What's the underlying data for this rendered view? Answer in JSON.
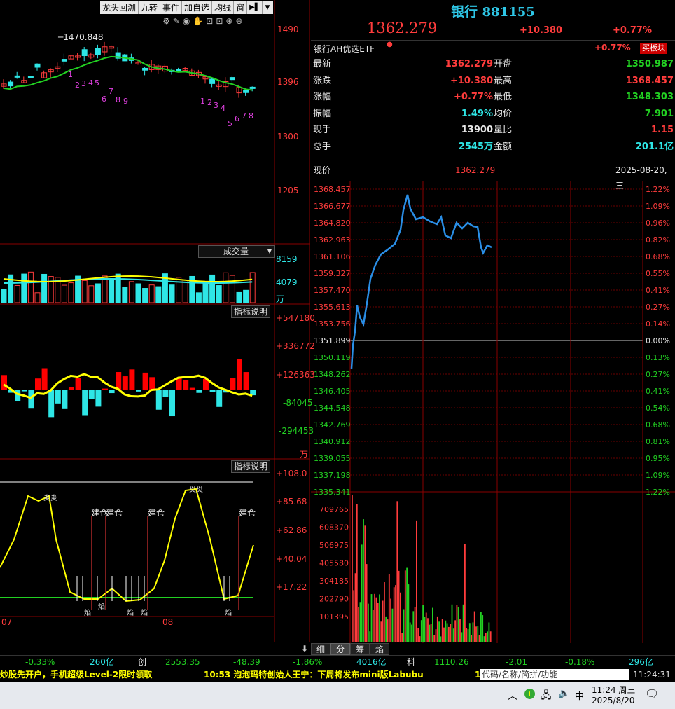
{
  "toolbar": {
    "items": [
      "龙头回溯",
      "九转",
      "事件",
      "加自选",
      "均线",
      "窗"
    ],
    "arrow_icon": "arrow-right-bar-icon",
    "dropdown_icon": "chevron-down-icon"
  },
  "kline": {
    "high_label": "1470.848",
    "y_ticks": [
      "1490",
      "1396",
      "1300",
      "1205"
    ],
    "nine_turn_labels": [
      "1",
      "2",
      "3",
      "4",
      "5",
      "6",
      "7",
      "8",
      "9",
      "1",
      "2",
      "3",
      "4",
      "5",
      "6",
      "7",
      "8"
    ],
    "icons": [
      "gear-icon",
      "pen-icon",
      "eye-icon",
      "hand-icon",
      "lock-icon",
      "lock-icon",
      "zoom-in-icon",
      "zoom-out-icon"
    ]
  },
  "volume": {
    "selector_label": "成交量",
    "y_ticks": [
      "8159",
      "4079"
    ],
    "unit": "万"
  },
  "indicator1": {
    "explain_label": "指标说明",
    "y_ticks": [
      "+547180",
      "+336772",
      "+126363",
      "-84045",
      "-294453"
    ],
    "unit": "万"
  },
  "indicator2": {
    "explain_label": "指标说明",
    "y_ticks": [
      "+108.0",
      "+85.68",
      "+62.86",
      "+40.04",
      "+17.22"
    ],
    "build_label": "建仓",
    "signal_labels": [
      "炎炎",
      "炎炎",
      "焰",
      "焰",
      "焰",
      "焰",
      "焰"
    ],
    "x_labels": [
      "07",
      "08"
    ]
  },
  "header": {
    "name": "银行",
    "code": "881155",
    "price": "1362.279",
    "change": "+10.380",
    "change_pct": "+0.77%",
    "etf_name": "银行AH优选ETF",
    "etf_change": "+0.77%",
    "buy_button": "买板块"
  },
  "stats": [
    {
      "l1": "最新",
      "v1": "1362.279",
      "c1": "red",
      "l2": "开盘",
      "v2": "1350.987",
      "c2": "green"
    },
    {
      "l1": "涨跌",
      "v1": "+10.380",
      "c1": "red",
      "l2": "最高",
      "v2": "1368.457",
      "c2": "red"
    },
    {
      "l1": "涨幅",
      "v1": "+0.77%",
      "c1": "red",
      "l2": "最低",
      "v2": "1348.303",
      "c2": "green"
    },
    {
      "l1": "振幅",
      "v1": "1.49%",
      "c1": "cyan",
      "l2": "均价",
      "v2": "7.901",
      "c2": "green"
    },
    {
      "l1": "现手",
      "v1": "13900",
      "c1": "white",
      "l2": "量比",
      "v2": "1.15",
      "c2": "red"
    },
    {
      "l1": "总手",
      "v1": "2545万",
      "c1": "cyan",
      "l2": "金额",
      "v2": "201.1亿",
      "c2": "cyan"
    }
  ],
  "intraday": {
    "label": "现价",
    "price": "1362.279",
    "date": "2025-08-20,三",
    "price_ticks": [
      "1368.457",
      "1366.677",
      "1364.820",
      "1362.963",
      "1361.106",
      "1359.327",
      "1357.470",
      "1355.613",
      "1353.756",
      "1351.899",
      "1350.119",
      "1348.262",
      "1346.405",
      "1344.548",
      "1342.769",
      "1340.912",
      "1339.055",
      "1337.198",
      "1335.341"
    ],
    "pct_ticks": [
      "1.22%",
      "1.09%",
      "0.96%",
      "0.82%",
      "0.68%",
      "0.55%",
      "0.41%",
      "0.27%",
      "0.14%",
      "0.00%",
      "0.13%",
      "0.27%",
      "0.41%",
      "0.54%",
      "0.68%",
      "0.81%",
      "0.95%",
      "1.09%",
      "1.22%"
    ],
    "vol_ticks": [
      "709765",
      "608370",
      "506975",
      "405580",
      "304185",
      "202790",
      "101395"
    ]
  },
  "bottom_tabs": [
    "细",
    "分",
    "筹",
    "焰"
  ],
  "index_bar": [
    {
      "text": "-0.33%",
      "c": "green"
    },
    {
      "text": "260亿",
      "c": "cyan"
    },
    {
      "text": "创",
      "c": "white"
    },
    {
      "text": "2553.35",
      "c": "green"
    },
    {
      "text": "-48.39",
      "c": "green"
    },
    {
      "text": "-1.86%",
      "c": "green"
    },
    {
      "text": "4016亿",
      "c": "cyan"
    },
    {
      "text": "科",
      "c": "white"
    },
    {
      "text": "1110.26",
      "c": "green"
    },
    {
      "text": "-2.01",
      "c": "green"
    },
    {
      "text": "-0.18%",
      "c": "green"
    },
    {
      "text": "296亿",
      "c": "cyan"
    }
  ],
  "news": {
    "left": "炒股先开户，手机超级Level-2限时领取",
    "right": "10:53 泡泡玛特创始人王宁：下周将发布mini版Labubu",
    "right_tail": "1",
    "search_placeholder": "代码/名称/简拼/功能",
    "clock": "11:24:31"
  },
  "taskbar": {
    "ime": "中",
    "time": "11:24 周三",
    "date": "2025/8/20"
  },
  "colors": {
    "up": "#ff3c3c",
    "down": "#22d022",
    "flat_line": "#22c022",
    "price_line": "#2a8ee6",
    "ma": "#ffff00"
  }
}
